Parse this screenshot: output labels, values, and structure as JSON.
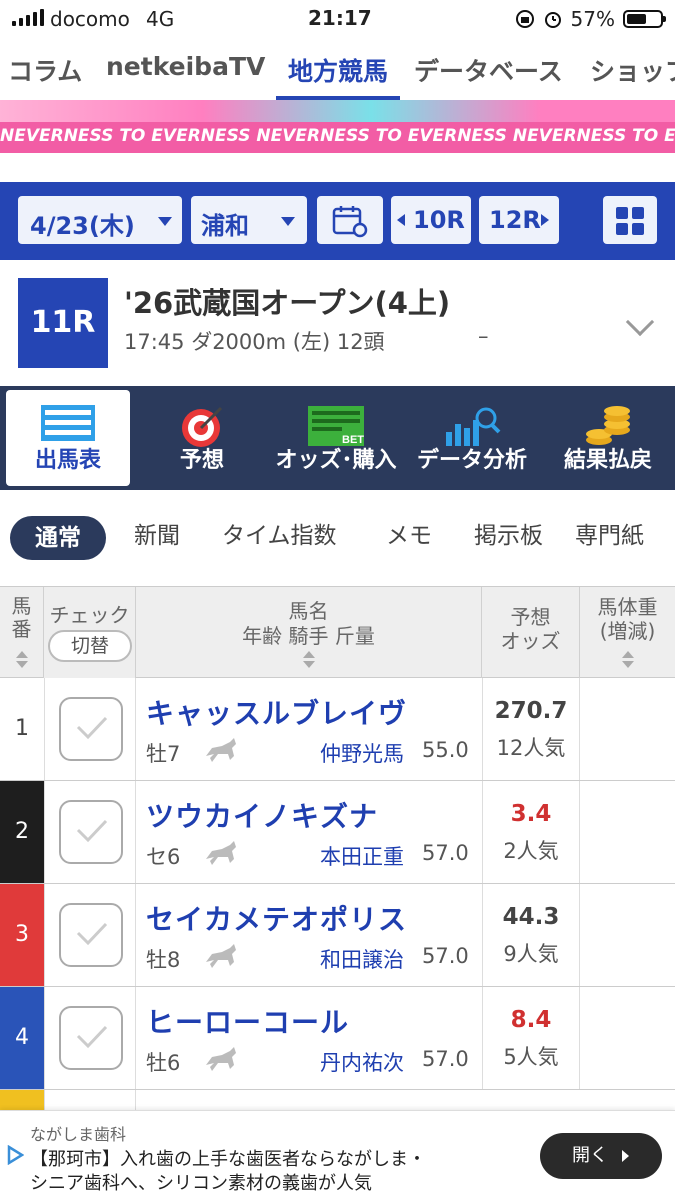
{
  "status_bar": {
    "carrier": "docomo",
    "network": "4G",
    "time": "21:17",
    "battery": "57%"
  },
  "top_nav": [
    "コラム",
    "netkeibaTV",
    "地方競馬",
    "データベース",
    "ショップ"
  ],
  "banner": {
    "text": "NEVERNESS TO EVERNESS   NEVERNESS TO EVERNESS   NEVERNESS TO EVERNESS   NEVERNESS TO EVERNESS"
  },
  "race_bar": {
    "date": "4/23(木)",
    "venue": "浦和",
    "prev_race": "10R",
    "next_race": "12R"
  },
  "race": {
    "number": "11R",
    "name": "'26武蔵国オープン(4上)",
    "info": "17:45 ダ2000m (左) 12頭",
    "dash": "–"
  },
  "menu": [
    "出馬表",
    "予想",
    "オッズ･購入",
    "データ分析",
    "結果払戻"
  ],
  "sub_tabs": [
    "通常",
    "新聞",
    "タイム指数",
    "メモ",
    "掲示板",
    "専門紙"
  ],
  "table_header": {
    "umaban": "馬番",
    "check": "チェック",
    "toggle": "切替",
    "horse_name": "馬名",
    "horse_sub": "年齢 騎手 斤量",
    "odds": "予想\nオッズ",
    "body_weight": "馬体重\n(増減)"
  },
  "colors": {
    "accent": "#2545b4",
    "dark": "#2b3a5c",
    "fav_odds": "#d03030"
  },
  "rows": [
    {
      "num": "1",
      "frame_bg": "#ffffff",
      "frame_fg": "#444444",
      "name": "キャッスルブレイヴ",
      "sex_age": "牡7",
      "jockey": "仲野光馬",
      "weight": "55.0",
      "odds": "270.7",
      "pop": "12人気",
      "fav": false
    },
    {
      "num": "2",
      "frame_bg": "#1e1e1e",
      "frame_fg": "#ffffff",
      "name": "ツウカイノキズナ",
      "sex_age": "セ6",
      "jockey": "本田正重",
      "weight": "57.0",
      "odds": "3.4",
      "pop": "2人気",
      "fav": true
    },
    {
      "num": "3",
      "frame_bg": "#e03a3a",
      "frame_fg": "#ffffff",
      "name": "セイカメテオポリス",
      "sex_age": "牡8",
      "jockey": "和田譲治",
      "weight": "57.0",
      "odds": "44.3",
      "pop": "9人気",
      "fav": false
    },
    {
      "num": "4",
      "frame_bg": "#2a54b8",
      "frame_fg": "#ffffff",
      "name": "ヒーローコール",
      "sex_age": "牡6",
      "jockey": "丹内祐次",
      "weight": "57.0",
      "odds": "8.4",
      "pop": "5人気",
      "fav": true
    }
  ],
  "ad": {
    "source": "ながしま歯科",
    "line1": "【那珂市】入れ歯の上手な歯医者ならながしま・",
    "line2": "シニア歯科へ、シリコン素材の義歯が人気",
    "button": "開く"
  }
}
